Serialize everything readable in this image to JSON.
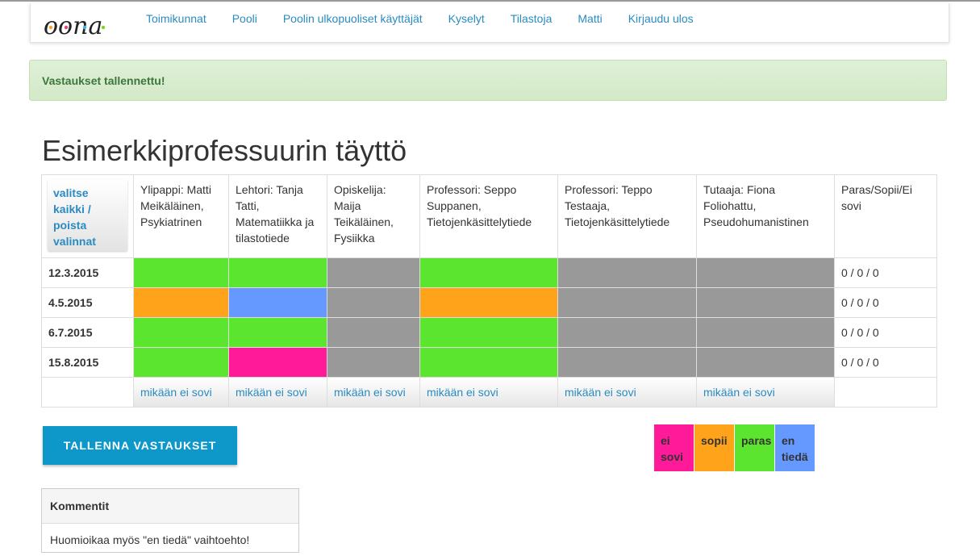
{
  "nav": {
    "logo_text": "oona",
    "links": [
      "Toimikunnat",
      "Pooli",
      "Poolin ulkopuoliset käyttäjät",
      "Kyselyt",
      "Tilastoja",
      "Matti",
      "Kirjaudu ulos"
    ]
  },
  "alert": {
    "message": "Vastaukset tallennettu!"
  },
  "page_title": "Esimerkkiprofessuurin täyttö",
  "table": {
    "select_all_label": "valitse kaikki / poista valinnat",
    "people": [
      "Ylipappi: Matti Meikäläinen, Psykiatrinen",
      "Lehtori: Tanja Tatti, Matematiikka ja tilastotiede",
      "Opiskelija: Maija Teikäläinen, Fysiikka",
      "Professori: Seppo Suppanen, Tietojenkäsittelytiede",
      "Professori: Teppo Testaaja, Tietojenkäsittelytiede",
      "Tutaaja: Fiona Foliohattu, Pseudohumanistinen"
    ],
    "summary_header": "Paras/Sopii/Ei sovi",
    "rows": [
      {
        "date": "12.3.2015",
        "cells": [
          "paras",
          "paras",
          "none",
          "paras",
          "none",
          "none"
        ],
        "summary": "0 / 0 / 0"
      },
      {
        "date": "4.5.2015",
        "cells": [
          "sopii",
          "en_tieda",
          "none",
          "sopii",
          "none",
          "none"
        ],
        "summary": "0 / 0 / 0"
      },
      {
        "date": "6.7.2015",
        "cells": [
          "paras",
          "paras",
          "none",
          "paras",
          "none",
          "none"
        ],
        "summary": "0 / 0 / 0"
      },
      {
        "date": "15.8.2015",
        "cells": [
          "paras",
          "ei_sovi",
          "none",
          "paras",
          "none",
          "none"
        ],
        "summary": "0 / 0 / 0"
      }
    ],
    "none_fits_label": "mikään ei sovi"
  },
  "colors": {
    "paras": "#5ce52e",
    "sopii": "#ffa31a",
    "ei_sovi": "#ff1a99",
    "en_tieda": "#6699ff",
    "none": "#999999"
  },
  "save_button": {
    "label": "TALLENNA VASTAUKSET"
  },
  "legend": [
    {
      "key": "ei_sovi",
      "label": "ei sovi"
    },
    {
      "key": "sopii",
      "label": "sopii"
    },
    {
      "key": "paras",
      "label": "paras"
    },
    {
      "key": "en_tieda",
      "label": "en tiedä"
    }
  ],
  "comments": {
    "title": "Kommentit",
    "items": [
      "Huomioikaa myös \"en tiedä\" vaihtoehto!"
    ]
  }
}
